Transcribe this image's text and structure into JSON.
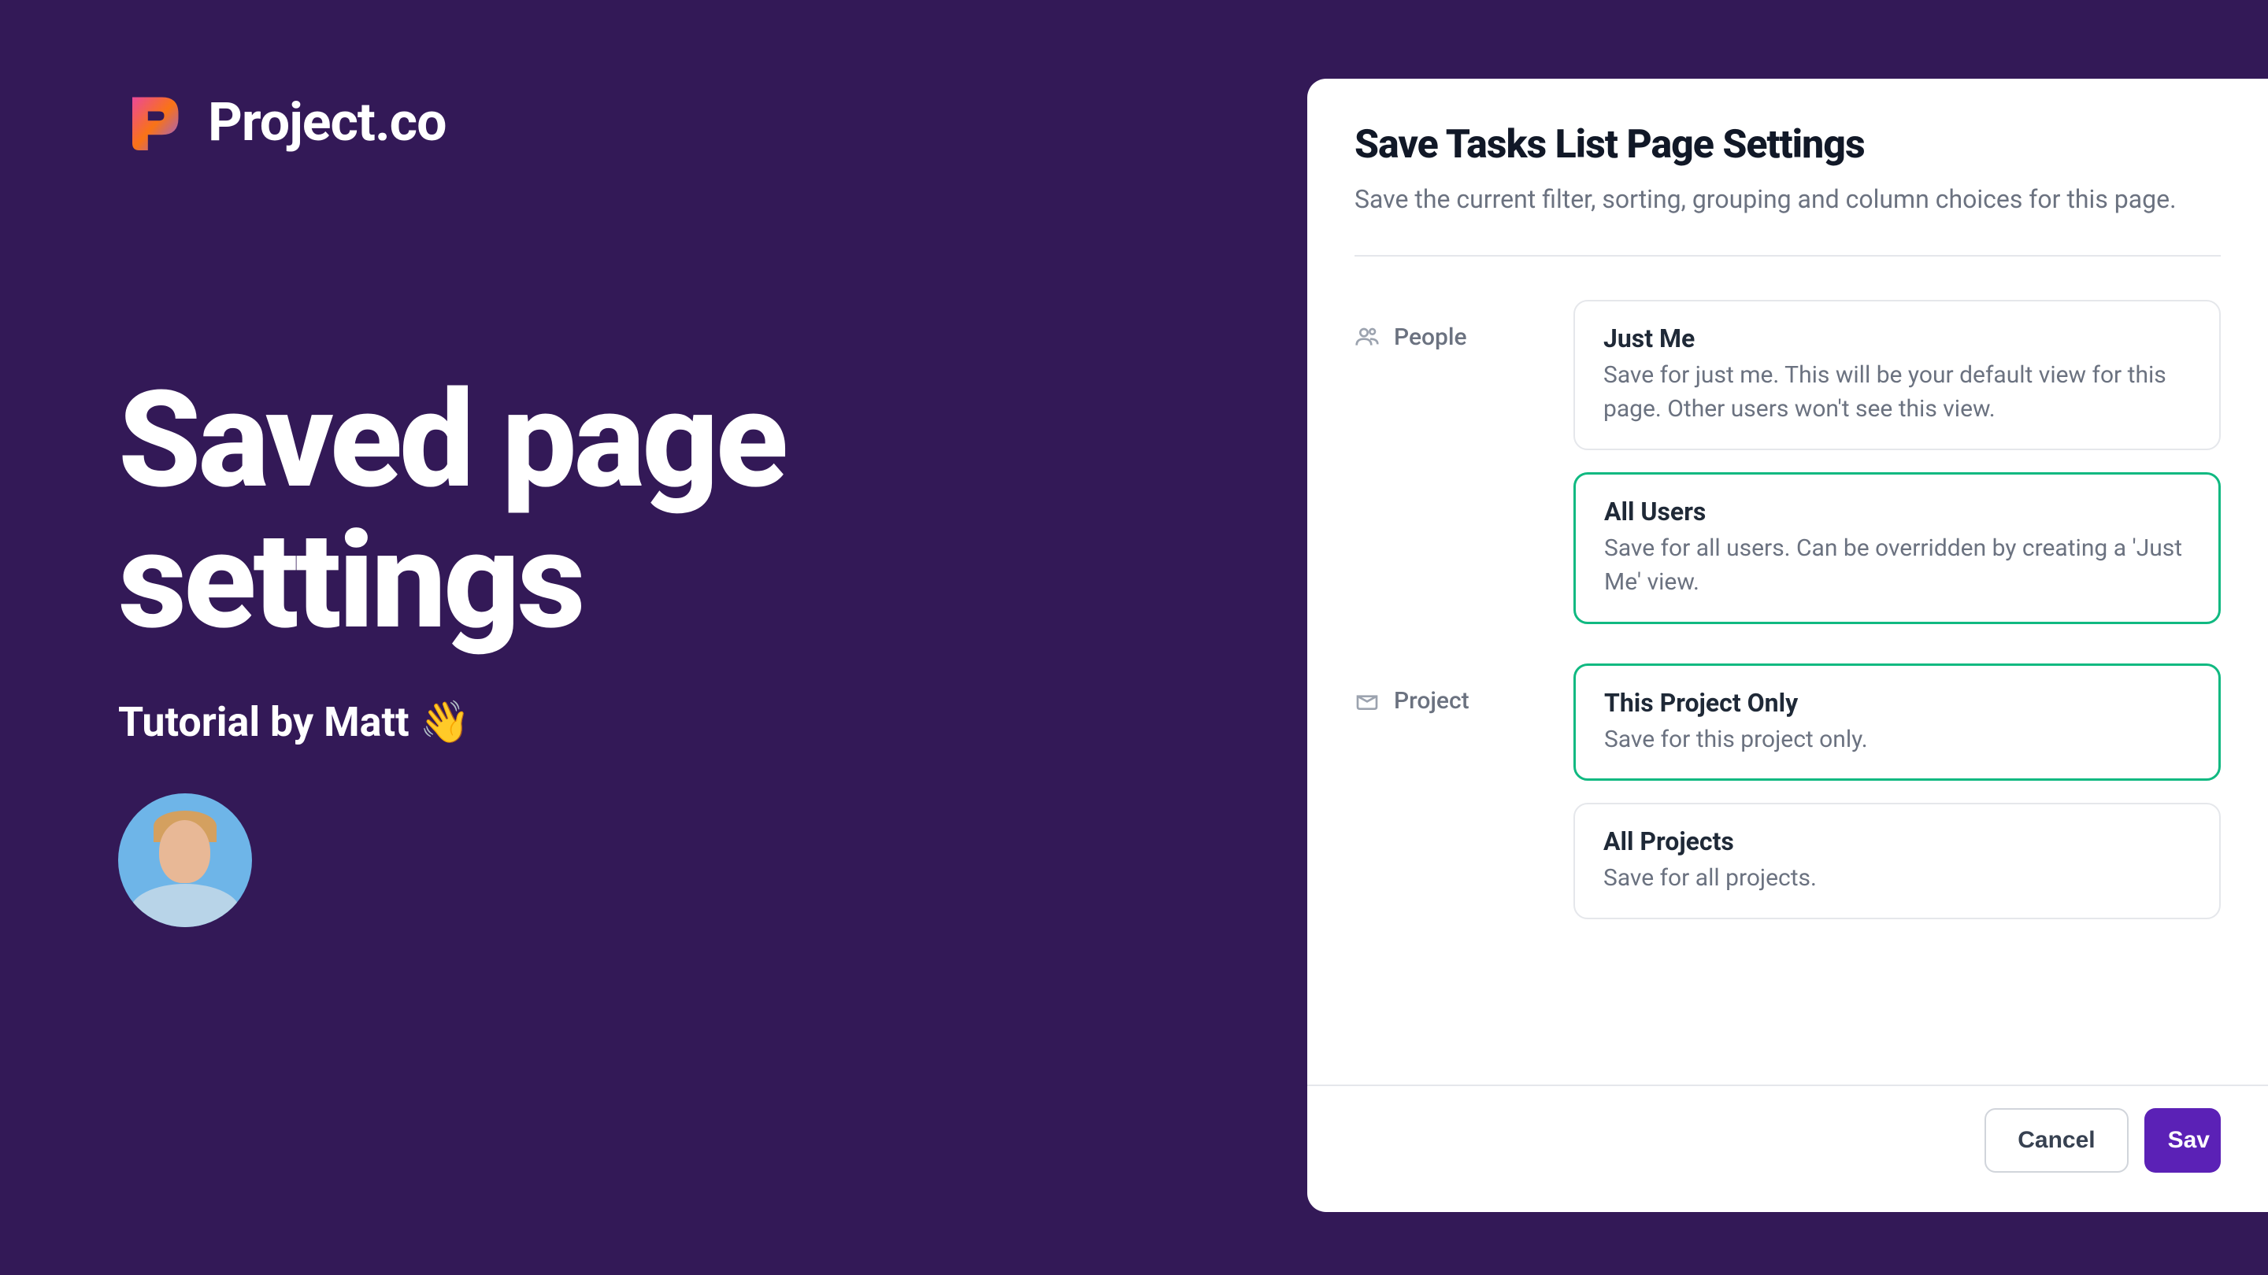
{
  "brand": {
    "name": "Project.co"
  },
  "hero": {
    "title_line1": "Saved page",
    "title_line2": "settings",
    "tutorial_by": "Tutorial by Matt",
    "wave": "👋"
  },
  "modal": {
    "title": "Save Tasks List Page Settings",
    "subtitle": "Save the current filter, sorting, grouping and column choices for this page.",
    "sections": {
      "people": {
        "label": "People",
        "options": [
          {
            "title": "Just Me",
            "desc": "Save for just me. This will be your default view for this page. Other users won't see this view.",
            "selected": false
          },
          {
            "title": "All Users",
            "desc": "Save for all users. Can be overridden by creating a 'Just Me' view.",
            "selected": true
          }
        ]
      },
      "project": {
        "label": "Project",
        "options": [
          {
            "title": "This Project Only",
            "desc": "Save for this project only.",
            "selected": true
          },
          {
            "title": "All Projects",
            "desc": "Save for all projects.",
            "selected": false
          }
        ]
      }
    },
    "buttons": {
      "cancel": "Cancel",
      "save": "Sav"
    }
  },
  "colors": {
    "background": "#331957",
    "selected_border": "#10b981",
    "primary_button": "#5b21b6"
  }
}
